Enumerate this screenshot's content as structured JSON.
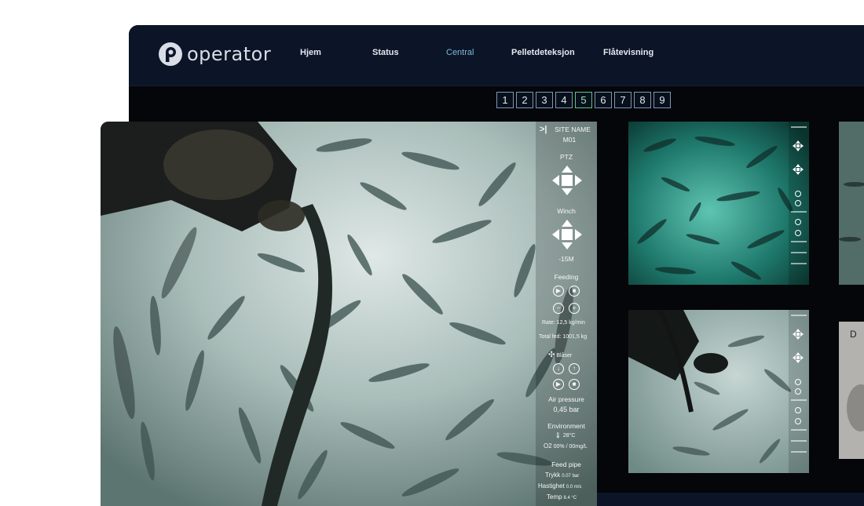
{
  "app": {
    "logo_text": "operator",
    "brand_color": "#7fb8d9"
  },
  "nav": {
    "items": [
      {
        "label": "Hjem"
      },
      {
        "label": "Status"
      },
      {
        "label": "Central",
        "active": true
      },
      {
        "label": "Pelletdeteksjon"
      },
      {
        "label": "Flåtevisning"
      }
    ]
  },
  "pager": {
    "pages": [
      "1",
      "2",
      "3",
      "4",
      "5",
      "6",
      "7",
      "8",
      "9"
    ],
    "active": "5"
  },
  "camera": {
    "collapse_label": ">|",
    "site_name_label": "SITE NAME",
    "site_name": "M01",
    "ptz_label": "PTZ",
    "winch_label": "Winch",
    "winch_depth": "-15M",
    "feeding_label": "Feeding",
    "rate": "Rate: 12,5 kg/min",
    "total_fed": "Total fed: 1001,5 kg",
    "blaser_label": "Blåser",
    "air_pressure_label": "Air pressure",
    "air_pressure": "0,45 bar",
    "environment_label": "Environment",
    "temperature": "28°C",
    "o2_label": "O2",
    "o2_value": "00% / 00mg/L",
    "feed_pipe_label": "Feed pipe",
    "trykk_label": "Trykk",
    "trykk_value": "0.07 bar",
    "hastighet_label": "Hastighet",
    "hastighet_value": "0.0 m/s",
    "temp_label": "Temp",
    "temp_value": "8.4 °C"
  },
  "icons": {
    "play": "play-icon",
    "stop": "stop-icon",
    "minus": "minus-icon",
    "plus": "plus-icon",
    "fan": "fan-icon",
    "thermometer": "thermometer-icon",
    "arrow_down": "arrow-down-icon",
    "arrow_up": "arrow-up-icon"
  }
}
